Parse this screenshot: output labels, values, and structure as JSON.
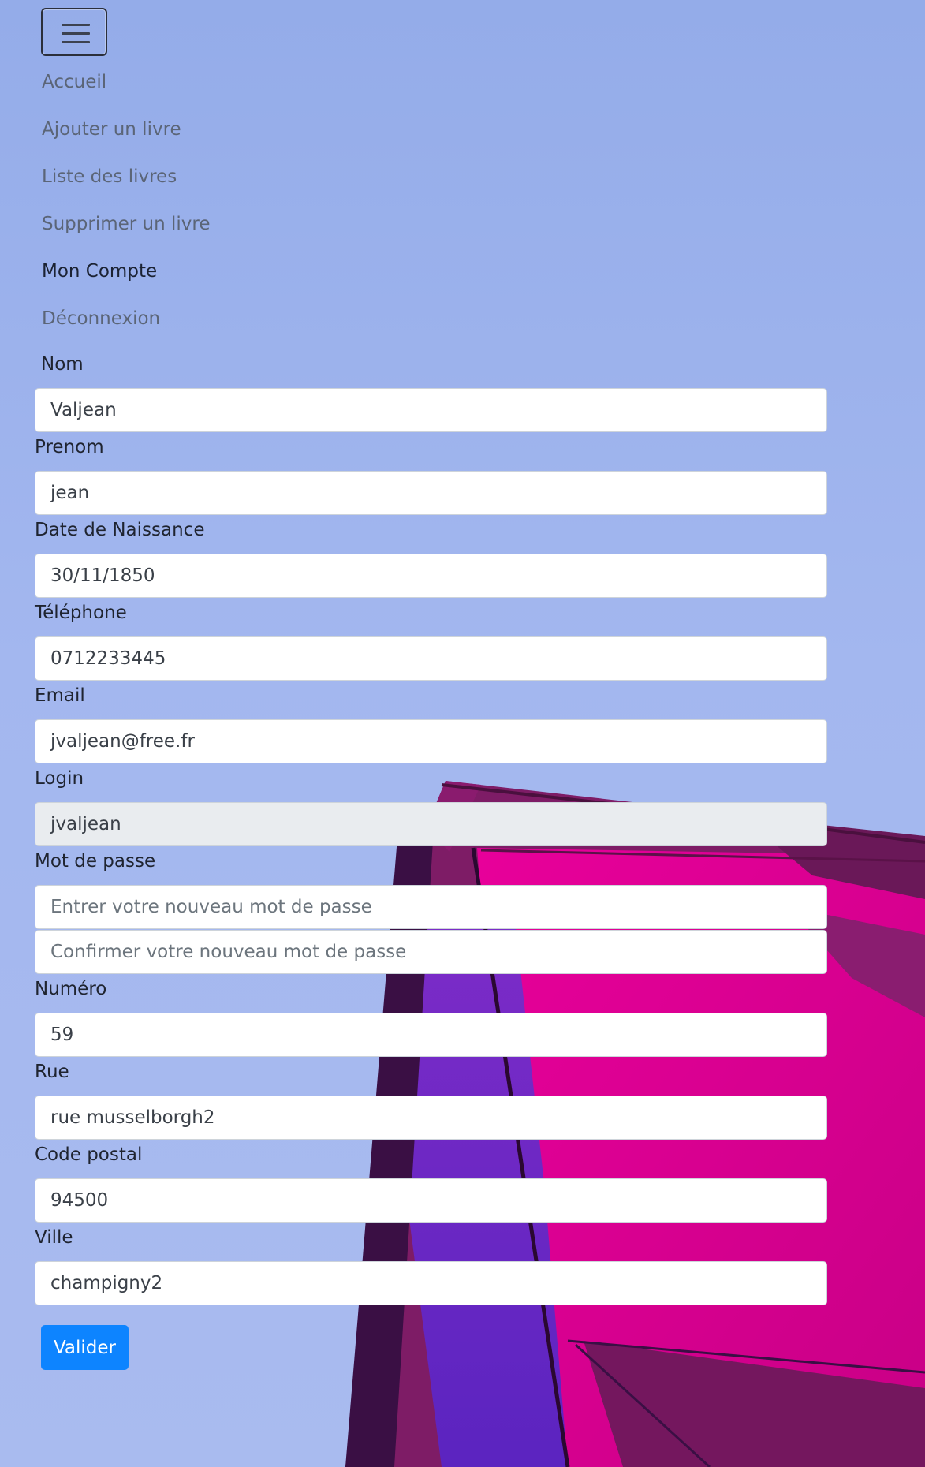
{
  "nav": {
    "toggle_icon": "hamburger-menu-icon",
    "items": [
      {
        "label": "Accueil",
        "active": false
      },
      {
        "label": "Ajouter un livre",
        "active": false
      },
      {
        "label": "Liste des livres",
        "active": false
      },
      {
        "label": "Supprimer un livre",
        "active": false
      },
      {
        "label": "Mon Compte",
        "active": true
      },
      {
        "label": "Déconnexion",
        "active": false
      }
    ]
  },
  "form": {
    "nom": {
      "label": "Nom",
      "value": "Valjean"
    },
    "prenom": {
      "label": "Prenom",
      "value": "jean"
    },
    "naissance": {
      "label": "Date de Naissance",
      "value": "30/11/1850"
    },
    "telephone": {
      "label": "Téléphone",
      "value": "0712233445"
    },
    "email": {
      "label": "Email",
      "value": "jvaljean@free.fr"
    },
    "login": {
      "label": "Login",
      "value": "jvaljean"
    },
    "password": {
      "label": "Mot de passe",
      "new_placeholder": "Entrer votre nouveau mot de passe",
      "confirm_placeholder": "Confirmer votre nouveau mot de passe"
    },
    "numero": {
      "label": "Numéro",
      "value": "59"
    },
    "rue": {
      "label": "Rue",
      "value": "rue musselborgh2"
    },
    "code_postal": {
      "label": "Code postal",
      "value": "94500"
    },
    "ville": {
      "label": "Ville",
      "value": "champigny2"
    },
    "submit_label": "Valider"
  },
  "colors": {
    "sky": "#a3b7ef",
    "primary_button": "#0d84ff",
    "magenta": "#e0008f",
    "purple": "#5b24c0"
  }
}
